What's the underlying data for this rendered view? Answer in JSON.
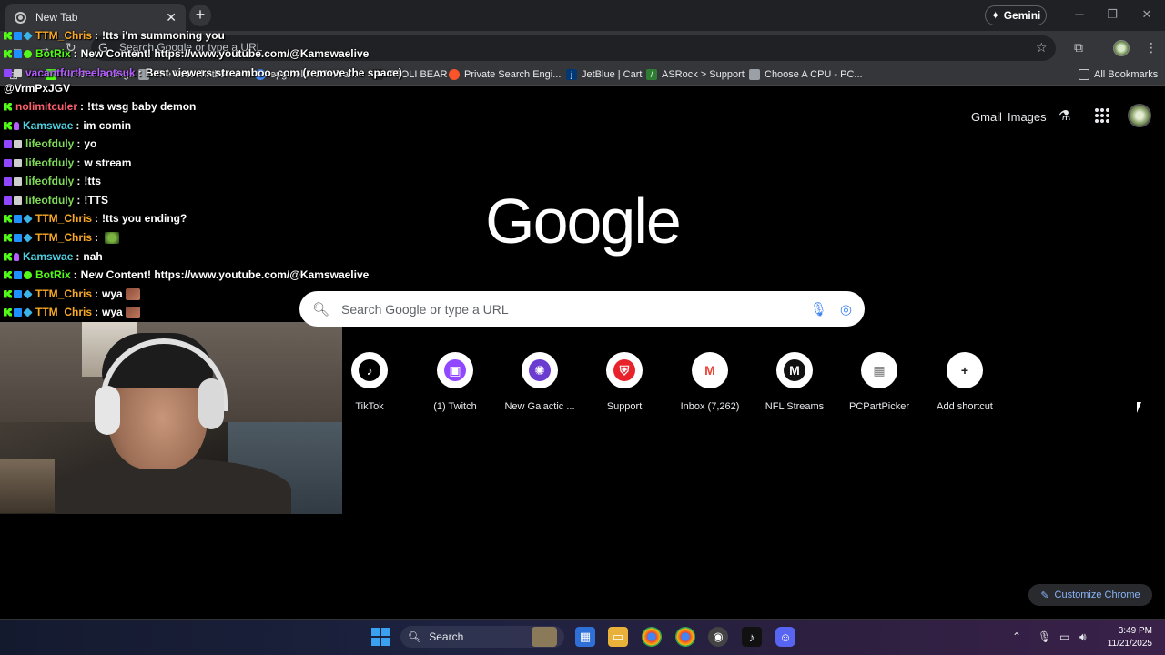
{
  "browser": {
    "tab": {
      "title": "New Tab"
    },
    "gemini_label": "Gemini",
    "omnibox_placeholder": "Search Google or type a URL",
    "bookmarks": [
      {
        "label": "KickBot Settings",
        "icon": "kickbot-icon",
        "color": "#53fc18"
      },
      {
        "label": "The best chatbot an...",
        "icon": "chatbot-icon",
        "color": "#9aa0a6"
      },
      {
        "label": "epg nelu technical...",
        "icon": "google-icon",
        "color": "#4285f4"
      },
      {
        "label": "TROLI BEAR",
        "icon": "troli-icon",
        "color": "#222222"
      },
      {
        "label": "Private Search Engi...",
        "icon": "brave-icon",
        "color": "#fb542b"
      },
      {
        "label": "JetBlue | Cart",
        "icon": "jetblue-icon",
        "color": "#003876"
      },
      {
        "label": "ASRock > Support",
        "icon": "asrock-icon",
        "color": "#2e7d32"
      },
      {
        "label": "Choose A CPU - PC...",
        "icon": "pcpartpicker-icon",
        "color": "#9aa0a6"
      }
    ],
    "all_bookmarks": "All Bookmarks"
  },
  "chat": [
    {
      "badges": [
        "kick",
        "mod",
        "gem"
      ],
      "user": "TTM_Chris",
      "user_color": "#f9a825",
      "message": "!tts i'm summoning you"
    },
    {
      "badges": [
        "kick",
        "mod",
        "verify"
      ],
      "user": "BotRix",
      "user_color": "#53fc18",
      "message": "New Content! https://www.youtube.com/@Kamswaelive"
    },
    {
      "badges": [
        "twitch",
        "grey"
      ],
      "user": "vacantfurtheelaotsuk",
      "user_color": "#b45cff",
      "message": "Best viewers streamboo .com (remove the space)"
    },
    {
      "badges": [],
      "user": "",
      "user_color": "#ffffff",
      "message": "@VrmPxJGV"
    },
    {
      "badges": [
        "kick"
      ],
      "user": "nolimitculer",
      "user_color": "#ff5f6d",
      "message": "!tts wsg baby demon"
    },
    {
      "badges": [
        "kick",
        "mic"
      ],
      "user": "Kamswae",
      "user_color": "#4dd0e1",
      "message": "im comin"
    },
    {
      "badges": [
        "twitch",
        "grey"
      ],
      "user": "lifeofduly",
      "user_color": "#7ed957",
      "message": "yo"
    },
    {
      "badges": [
        "twitch",
        "grey"
      ],
      "user": "lifeofduly",
      "user_color": "#7ed957",
      "message": "w stream"
    },
    {
      "badges": [
        "twitch",
        "grey"
      ],
      "user": "lifeofduly",
      "user_color": "#7ed957",
      "message": "!tts"
    },
    {
      "badges": [
        "twitch",
        "grey"
      ],
      "user": "lifeofduly",
      "user_color": "#7ed957",
      "message": "!TTS"
    },
    {
      "badges": [
        "kick",
        "mod",
        "gem"
      ],
      "user": "TTM_Chris",
      "user_color": "#f9a825",
      "message": "!tts you ending?"
    },
    {
      "badges": [
        "kick",
        "mod",
        "gem"
      ],
      "user": "TTM_Chris",
      "user_color": "#f9a825",
      "message": "",
      "emote": "green"
    },
    {
      "badges": [
        "kick",
        "mic"
      ],
      "user": "Kamswae",
      "user_color": "#4dd0e1",
      "message": "nah"
    },
    {
      "badges": [
        "kick",
        "mod",
        "verify"
      ],
      "user": "BotRix",
      "user_color": "#53fc18",
      "message": "New Content! https://www.youtube.com/@Kamswaelive"
    },
    {
      "badges": [
        "kick",
        "mod",
        "gem"
      ],
      "user": "TTM_Chris",
      "user_color": "#f9a825",
      "message": "wya",
      "emote": "red"
    },
    {
      "badges": [
        "kick",
        "mod",
        "gem"
      ],
      "user": "TTM_Chris",
      "user_color": "#f9a825",
      "message": "wya",
      "emote": "red"
    }
  ],
  "google": {
    "gmail": "Gmail",
    "images": "Images",
    "logo": "Google",
    "search_placeholder": "Search Google or type a URL",
    "shortcuts": [
      {
        "label": "TikTok",
        "icon": "tiktok-icon",
        "glyph": "♪",
        "bg": "#000000",
        "fg": "#ffffff"
      },
      {
        "label": "(1) Twitch",
        "icon": "twitch-icon",
        "glyph": "▣",
        "bg": "#9146ff",
        "fg": "#ffffff"
      },
      {
        "label": "New Galactic ...",
        "icon": "galactic-icon",
        "glyph": "✺",
        "bg": "#6a3cd0",
        "fg": "#ffffff"
      },
      {
        "label": "Support",
        "icon": "msi-shield-icon",
        "glyph": "⛨",
        "bg": "#e8222b",
        "fg": "#ffffff"
      },
      {
        "label": "Inbox (7,262)",
        "icon": "gmail-icon",
        "glyph": "M",
        "bg": "#ffffff",
        "fg": "#ea4335"
      },
      {
        "label": "NFL Streams",
        "icon": "nfl-streams-icon",
        "glyph": "M",
        "bg": "#111111",
        "fg": "#ffffff"
      },
      {
        "label": "PCPartPicker",
        "icon": "pcpartpicker-icon",
        "glyph": "▦",
        "bg": "#ffffff",
        "fg": "#7a7a7a"
      },
      {
        "label": "Add shortcut",
        "icon": "plus-icon",
        "glyph": "+",
        "bg": "#ffffff",
        "fg": "#202124"
      }
    ],
    "customize": "Customize Chrome"
  },
  "taskbar": {
    "search_label": "Search",
    "time": "3:49 PM",
    "date": "11/21/2025"
  }
}
